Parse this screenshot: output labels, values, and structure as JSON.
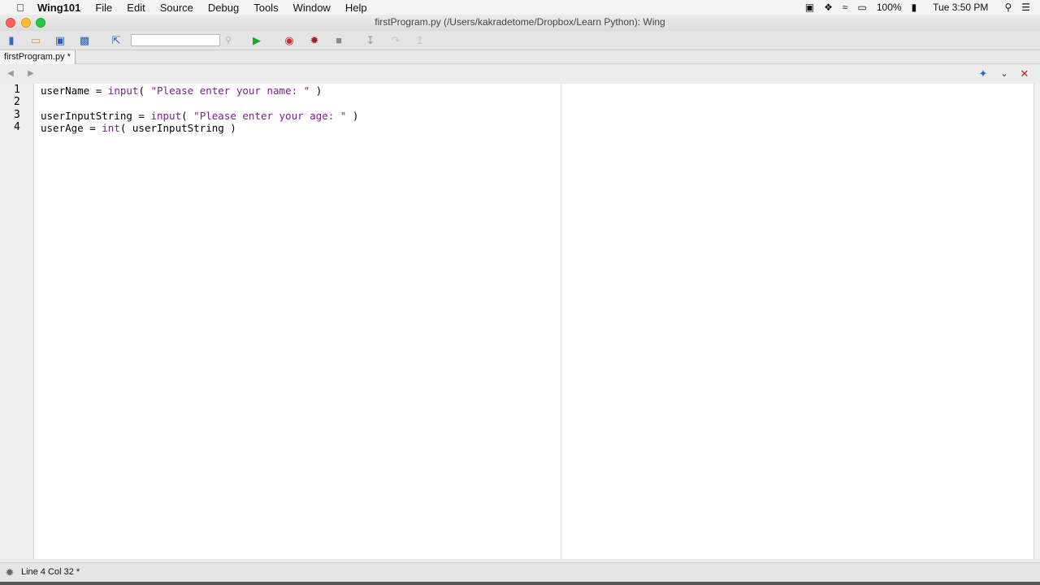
{
  "menubar": {
    "app_name": "Wing101",
    "items": [
      "File",
      "Edit",
      "Source",
      "Debug",
      "Tools",
      "Window",
      "Help"
    ],
    "battery": "100%",
    "clock": "Tue 3:50 PM"
  },
  "window": {
    "title": "firstProgram.py (/Users/kakradetome/Dropbox/Learn Python): Wing"
  },
  "toolbar": {
    "search_value": ""
  },
  "tabs": [
    {
      "label": "firstProgram.py *"
    }
  ],
  "editor": {
    "line_numbers": [
      "1",
      "2",
      "3",
      "4"
    ],
    "lines": [
      {
        "parts": [
          {
            "t": "userName = ",
            "c": ""
          },
          {
            "t": "input",
            "c": "kw"
          },
          {
            "t": "( ",
            "c": ""
          },
          {
            "t": "\"Please enter your name: \"",
            "c": "str"
          },
          {
            "t": " )",
            "c": ""
          }
        ]
      },
      {
        "parts": []
      },
      {
        "parts": [
          {
            "t": "userInputString = ",
            "c": ""
          },
          {
            "t": "input",
            "c": "kw"
          },
          {
            "t": "( ",
            "c": ""
          },
          {
            "t": "\"Please enter your age: \"",
            "c": "str"
          },
          {
            "t": " )",
            "c": ""
          }
        ]
      },
      {
        "parts": [
          {
            "t": "userAge = ",
            "c": ""
          },
          {
            "t": "int",
            "c": "kw"
          },
          {
            "t": "( userInputString )",
            "c": ""
          }
        ]
      }
    ]
  },
  "status": {
    "text": "Line 4 Col 32 *"
  }
}
